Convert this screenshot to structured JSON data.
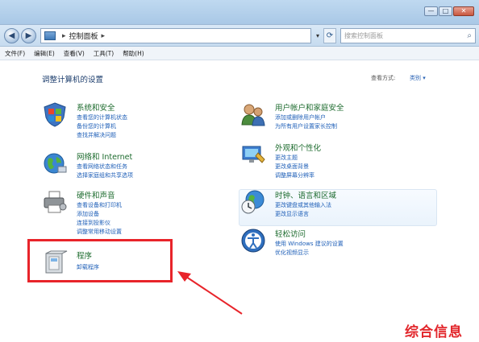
{
  "window": {
    "minimize": "—",
    "maximize": "□",
    "close": "✕"
  },
  "address": {
    "back": "◀",
    "forward": "▶",
    "path": "控制面板",
    "separator": "▸",
    "dropdown": "▾",
    "refresh": "⟳",
    "search_placeholder": "搜索控制面板"
  },
  "menu": [
    "文件(F)",
    "编辑(E)",
    "查看(V)",
    "工具(T)",
    "帮助(H)"
  ],
  "content": {
    "heading": "调整计算机的设置",
    "view_by_label": "查看方式:",
    "view_by_value": "类别 ▾",
    "categories": [
      {
        "title": "系统和安全",
        "links": [
          "查看您的计算机状态",
          "备份您的计算机",
          "查找并解决问题"
        ],
        "icon": "shield-icon"
      },
      {
        "title": "网络和 Internet",
        "links": [
          "查看网络状态和任务",
          "选择家庭组和共享选项"
        ],
        "icon": "network-globe-icon"
      },
      {
        "title": "硬件和声音",
        "links": [
          "查看设备和打印机",
          "添加设备",
          "连接到投影仪",
          "调整常用移动设置"
        ],
        "icon": "printer-icon"
      },
      {
        "title": "程序",
        "links": [
          "卸载程序"
        ],
        "icon": "programs-icon"
      },
      {
        "title": "用户帐户和家庭安全",
        "links": [
          "添加或删除用户帐户",
          "为所有用户设置家长控制"
        ],
        "icon": "users-icon"
      },
      {
        "title": "外观和个性化",
        "links": [
          "更改主题",
          "更改桌面背景",
          "调整屏幕分辨率"
        ],
        "icon": "appearance-icon"
      },
      {
        "title": "时钟、语言和区域",
        "links": [
          "更改键盘或其他输入法",
          "更改显示语言"
        ],
        "icon": "clock-globe-icon"
      },
      {
        "title": "轻松访问",
        "links": [
          "使用 Windows 建议的设置",
          "优化视频显示"
        ],
        "icon": "ease-of-access-icon"
      }
    ]
  },
  "annotation": {
    "highlight_color": "#e8242a"
  },
  "watermark": "综合信息"
}
